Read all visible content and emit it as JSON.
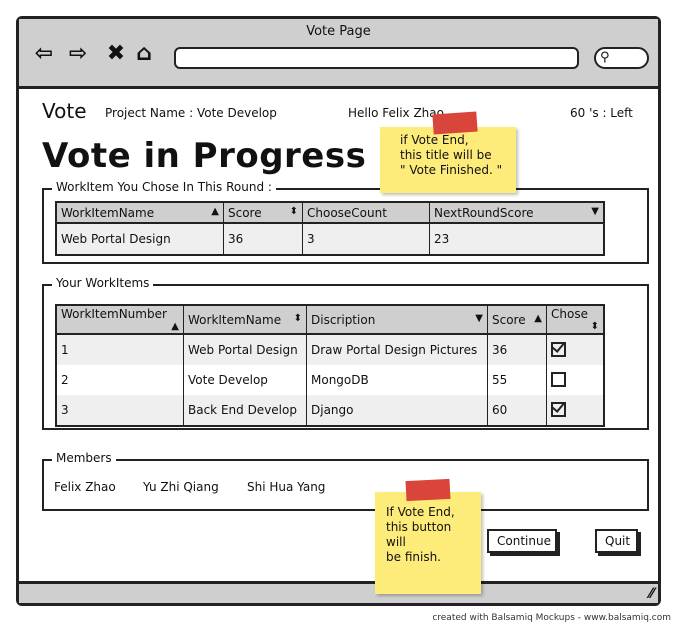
{
  "window": {
    "title": "Vote Page"
  },
  "browser": {
    "back_icon": "arrow-left-icon",
    "forward_icon": "arrow-right-icon",
    "stop_icon": "close-icon",
    "home_icon": "home-icon",
    "search_icon": "search-icon"
  },
  "header": {
    "logo": "Vote",
    "project": "Project Name : Vote Develop",
    "greeting": "Hello Felix Zhao",
    "timer": "60 's : Left"
  },
  "page_title": "Vote in Progress ...",
  "note_title": {
    "line1": "if Vote End,",
    "line2": "this title will be",
    "line3": "\" Vote Finished. \""
  },
  "chosen": {
    "legend": "WorkItem You Chose In This Round :",
    "columns": [
      "WorkItemName",
      "Score",
      "ChooseCount",
      "NextRoundScore"
    ],
    "rows": [
      [
        "Web Portal Design",
        "36",
        "3",
        "23"
      ]
    ]
  },
  "your_items": {
    "legend": "Your WorkItems",
    "columns": [
      "WorkItemNumber",
      "WorkItemName",
      "Discription",
      "Score",
      "Chose"
    ],
    "rows": [
      {
        "number": "1",
        "name": "Web Portal Design",
        "description": "Draw Portal Design Pictures",
        "score": "36",
        "chose": true
      },
      {
        "number": "2",
        "name": "Vote Develop",
        "description": "MongoDB",
        "score": "55",
        "chose": false
      },
      {
        "number": "3",
        "name": "Back End Develop",
        "description": "Django",
        "score": "60",
        "chose": true
      }
    ]
  },
  "members": {
    "legend": "Members",
    "names": [
      "Felix Zhao",
      "Yu Zhi Qiang",
      "Shi Hua Yang"
    ]
  },
  "note_button": {
    "line1": "If Vote End,",
    "line2": "this button will",
    "line3": "be finish."
  },
  "actions": {
    "continue": "Continue",
    "quit": "Quit"
  },
  "credit": "created with Balsamiq Mockups - www.balsamiq.com",
  "colors": {
    "chrome": "#cfcfcf",
    "sticky": "#fdeb7a",
    "tape": "#d9453a",
    "row_alt": "#efefef"
  }
}
